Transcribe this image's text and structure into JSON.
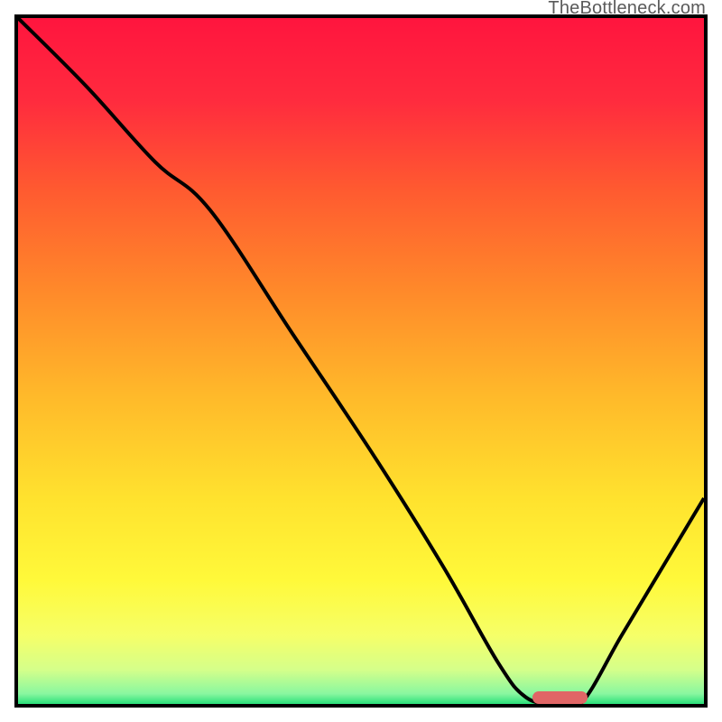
{
  "watermark": "TheBottleneck.com",
  "colors": {
    "gradient_stops": [
      {
        "offset": 0.0,
        "color": "#ff153e"
      },
      {
        "offset": 0.12,
        "color": "#ff2b3e"
      },
      {
        "offset": 0.25,
        "color": "#ff5a30"
      },
      {
        "offset": 0.4,
        "color": "#ff8a2a"
      },
      {
        "offset": 0.55,
        "color": "#ffb92a"
      },
      {
        "offset": 0.7,
        "color": "#ffe22e"
      },
      {
        "offset": 0.82,
        "color": "#fff93a"
      },
      {
        "offset": 0.9,
        "color": "#f6ff68"
      },
      {
        "offset": 0.95,
        "color": "#d5ff8a"
      },
      {
        "offset": 0.985,
        "color": "#89f7a0"
      },
      {
        "offset": 1.0,
        "color": "#2be07a"
      }
    ],
    "curve": "#000000",
    "marker": "#e06666",
    "border": "#000000"
  },
  "chart_data": {
    "type": "line",
    "title": "",
    "xlabel": "",
    "ylabel": "",
    "xlim": [
      0,
      100
    ],
    "ylim": [
      0,
      100
    ],
    "series": [
      {
        "name": "bottleneck-curve",
        "x": [
          0,
          10,
          20,
          28,
          40,
          52,
          62,
          70,
          74,
          78,
          82,
          88,
          94,
          100
        ],
        "y": [
          100,
          90,
          79,
          72,
          54,
          36,
          20,
          6,
          1,
          0,
          0,
          10,
          20,
          30
        ]
      }
    ],
    "annotations": [
      {
        "name": "optimal-marker",
        "x_start": 75,
        "x_end": 83,
        "y": 0
      }
    ]
  }
}
